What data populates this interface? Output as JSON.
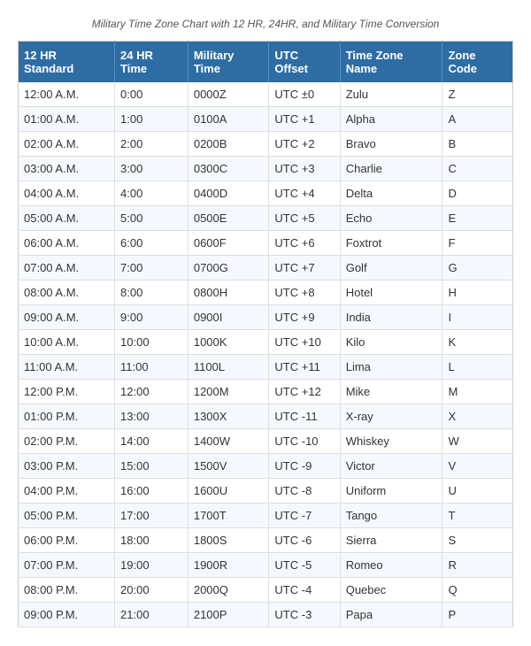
{
  "subtitle": "Military Time Zone Chart with 12 HR, 24HR, and Military Time Conversion",
  "headers": [
    "12 HR Standard",
    "24 HR Time",
    "Military Time",
    "UTC Offset",
    "Time Zone Name",
    "Zone Code"
  ],
  "rows": [
    [
      "12:00 A.M.",
      "0:00",
      "0000Z",
      "UTC ±0",
      "Zulu",
      "Z"
    ],
    [
      "01:00 A.M.",
      "1:00",
      "0100A",
      "UTC +1",
      "Alpha",
      "A"
    ],
    [
      "02:00 A.M.",
      "2:00",
      "0200B",
      "UTC +2",
      "Bravo",
      "B"
    ],
    [
      "03:00 A.M.",
      "3:00",
      "0300C",
      "UTC +3",
      "Charlie",
      "C"
    ],
    [
      "04:00 A.M.",
      "4:00",
      "0400D",
      "UTC +4",
      "Delta",
      "D"
    ],
    [
      "05:00 A.M.",
      "5:00",
      "0500E",
      "UTC +5",
      "Echo",
      "E"
    ],
    [
      "06:00 A.M.",
      "6:00",
      "0600F",
      "UTC +6",
      "Foxtrot",
      "F"
    ],
    [
      "07:00 A.M.",
      "7:00",
      "0700G",
      "UTC +7",
      "Golf",
      "G"
    ],
    [
      "08:00 A.M.",
      "8:00",
      "0800H",
      "UTC +8",
      "Hotel",
      "H"
    ],
    [
      "09:00 A.M.",
      "9:00",
      "0900I",
      "UTC +9",
      "India",
      "I"
    ],
    [
      "10:00 A.M.",
      "10:00",
      "1000K",
      "UTC +10",
      "Kilo",
      "K"
    ],
    [
      "11:00 A.M.",
      "11:00",
      "1100L",
      "UTC +11",
      "Lima",
      "L"
    ],
    [
      "12:00 P.M.",
      "12:00",
      "1200M",
      "UTC +12",
      "Mike",
      "M"
    ],
    [
      "01:00 P.M.",
      "13:00",
      "1300X",
      "UTC -11",
      "X-ray",
      "X"
    ],
    [
      "02:00 P.M.",
      "14:00",
      "1400W",
      "UTC -10",
      "Whiskey",
      "W"
    ],
    [
      "03:00 P.M.",
      "15:00",
      "1500V",
      "UTC -9",
      "Victor",
      "V"
    ],
    [
      "04:00 P.M.",
      "16:00",
      "1600U",
      "UTC -8",
      "Uniform",
      "U"
    ],
    [
      "05:00 P.M.",
      "17:00",
      "1700T",
      "UTC -7",
      "Tango",
      "T"
    ],
    [
      "06:00 P.M.",
      "18:00",
      "1800S",
      "UTC -6",
      "Sierra",
      "S"
    ],
    [
      "07:00 P.M.",
      "19:00",
      "1900R",
      "UTC -5",
      "Romeo",
      "R"
    ],
    [
      "08:00 P.M.",
      "20:00",
      "2000Q",
      "UTC -4",
      "Quebec",
      "Q"
    ],
    [
      "09:00 P.M.",
      "21:00",
      "2100P",
      "UTC -3",
      "Papa",
      "P"
    ]
  ]
}
